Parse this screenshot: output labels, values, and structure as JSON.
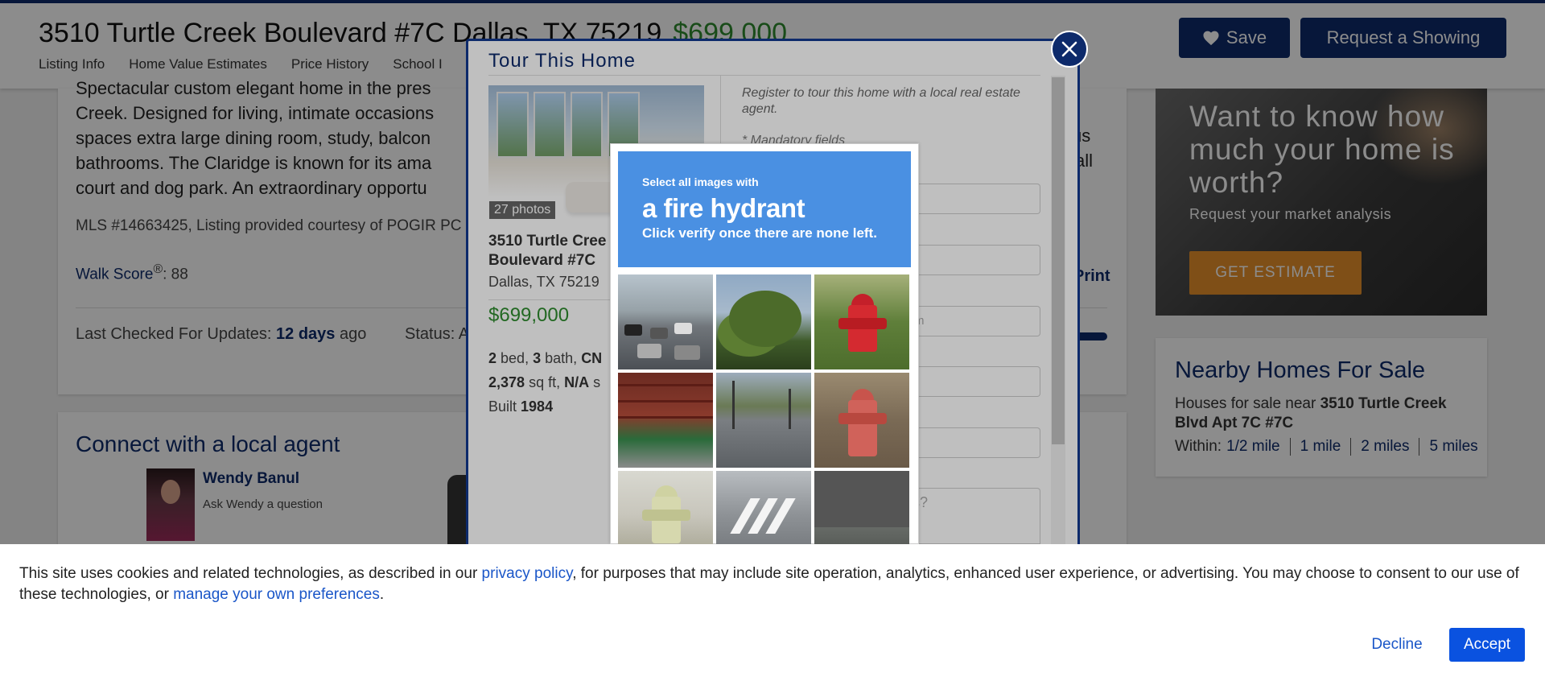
{
  "header": {
    "address": "3510 Turtle Creek Boulevard #7C Dallas, TX 75219",
    "price": "$699,000",
    "nav": [
      "Listing Info",
      "Home Value Estimates",
      "Price History",
      "School I"
    ],
    "save_label": "Save",
    "request_label": "Request a Showing"
  },
  "listing": {
    "description_lines": [
      "Spectacular custom elegant home in the pres",
      "Creek. Designed for living, intimate occasions",
      "spaces extra large dining room, study, balcon",
      "bathrooms. The Claridge is known for its ama",
      "court and dog park. An extraordinary opportu"
    ],
    "description_right": [
      "us",
      "all"
    ],
    "mls": "MLS #14663425, Listing provided courtesy of POGIR PC",
    "walk_score_label": "Walk Score",
    "walk_score_sup": "®",
    "walk_score_value": ": 88",
    "print_label": "Print",
    "last_checked_label": "Last Checked For Updates:",
    "last_checked_value": "12 days",
    "last_checked_suffix": "ago",
    "status_label": "Status: A"
  },
  "connect": {
    "title": "Connect with a local agent",
    "agent_name": "Wendy Banul",
    "agent_ask": "Ask Wendy a question"
  },
  "sidebar": {
    "ad_headline": "Want to know how much your home is worth?",
    "ad_sub": "Request your market analysis",
    "ad_button": "GET ESTIMATE",
    "nearby_title": "Nearby Homes For Sale",
    "nearby_prefix": "Houses for sale near",
    "nearby_address": "3510 Turtle Creek Blvd Apt 7C #7C",
    "within_label": "Within:",
    "within_options": [
      "1/2 mile",
      "1 mile",
      "2 miles",
      "5 miles"
    ]
  },
  "modal": {
    "title": "Tour This Home",
    "photo_count": "27 photos",
    "address": "3510 Turtle Cree Boulevard #7C",
    "city": "Dallas, TX 75219",
    "price": "$699,000",
    "beds": "2",
    "beds_label": "bed,",
    "baths": "3",
    "baths_label": "bath,",
    "type": "CN",
    "sqft": "2,378",
    "sqft_label": "sq ft,",
    "lot": "N/A",
    "lot_label": "s",
    "built_label": "Built",
    "built_year": "1984",
    "intro": "Register to tour this home with a local real estate agent.",
    "mandatory": "* Mandatory fields",
    "field_placeholder_email": "m",
    "textarea_placeholder": "s?"
  },
  "captcha": {
    "line1": "Select all images with",
    "target": "a fire hydrant",
    "line3": "Click verify once there are none left."
  },
  "cookie": {
    "text_before_privacy": "This site uses cookies and related technologies, as described in our ",
    "privacy_link": "privacy policy",
    "text_middle": ", for purposes that may include site operation, analytics, enhanced user experience, or advertising. You may choose to consent to our use of these technologies, or ",
    "prefs_link": "manage your own preferences",
    "text_end": ".",
    "decline": "Decline",
    "accept": "Accept"
  },
  "colors": {
    "brand_navy": "#0d2a6b",
    "price_green": "#2e8b2e",
    "captcha_blue": "#4a90e2",
    "accept_blue": "#0a52e0",
    "ad_orange": "#e8912a"
  }
}
